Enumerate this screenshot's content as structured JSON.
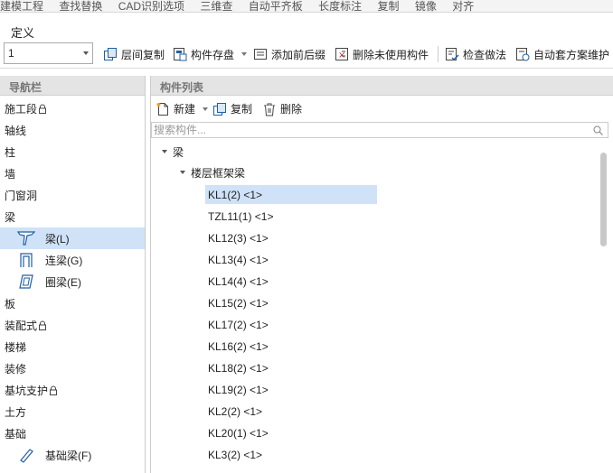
{
  "top_strip": [
    "建模工程",
    "查找替换",
    "CAD识别选项",
    "三维查",
    "自动平齐板",
    "长度标注",
    "复制",
    "镜像",
    "对齐"
  ],
  "definition_label": "定义",
  "floor_select": {
    "value": "1"
  },
  "toolbar": {
    "copy_between_floors": "层间复制",
    "component_save": "构件存盘",
    "add_prefix_suffix": "添加前后缀",
    "delete_unused": "删除未使用构件",
    "check_method": "检查做法",
    "auto_scheme": "自动套方案维护"
  },
  "nav": {
    "header": "导航栏",
    "items": [
      {
        "label": "施工段",
        "lock": true,
        "sub": false
      },
      {
        "label": "轴线",
        "sub": false
      },
      {
        "label": "柱",
        "sub": false
      },
      {
        "label": "墙",
        "sub": false
      },
      {
        "label": "门窗洞",
        "sub": false
      },
      {
        "label": "梁",
        "sub": false
      },
      {
        "label": "梁(L)",
        "sub": true,
        "icon": "beam-icon",
        "active": true
      },
      {
        "label": "连梁(G)",
        "sub": true,
        "icon": "link-beam-icon"
      },
      {
        "label": "圈梁(E)",
        "sub": true,
        "icon": "ring-beam-icon"
      },
      {
        "label": "板",
        "sub": false
      },
      {
        "label": "装配式",
        "lock": true,
        "sub": false
      },
      {
        "label": "楼梯",
        "sub": false
      },
      {
        "label": "装修",
        "sub": false
      },
      {
        "label": "基坑支护",
        "lock": true,
        "sub": false
      },
      {
        "label": "土方",
        "sub": false
      },
      {
        "label": "基础",
        "sub": false
      },
      {
        "label": "基础梁(F)",
        "sub": true,
        "icon": "foundation-beam-icon"
      }
    ]
  },
  "component_list": {
    "header": "构件列表",
    "new_label": "新建",
    "copy_label": "复制",
    "delete_label": "删除",
    "search_placeholder": "搜索构件...",
    "root": "梁",
    "group": "楼层框架梁",
    "items": [
      "KL1(2) <1>",
      "TZL11(1) <1>",
      "KL12(3) <1>",
      "KL13(4) <1>",
      "KL14(4) <1>",
      "KL15(2) <1>",
      "KL17(2) <1>",
      "KL16(2) <1>",
      "KL18(2) <1>",
      "KL19(2) <1>",
      "KL2(2) <1>",
      "KL20(1) <1>",
      "KL3(2) <1>"
    ],
    "selected_index": 0
  }
}
